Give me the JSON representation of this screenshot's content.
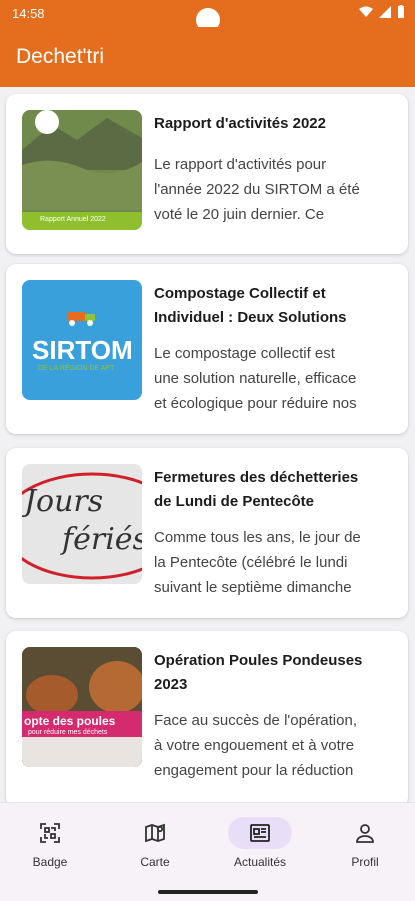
{
  "status": {
    "time": "14:58"
  },
  "app": {
    "title": "Dechet'tri"
  },
  "articles": [
    {
      "title": "Rapport d'activités 2022",
      "excerpt_lines": [
        "Le rapport d'activités pour",
        "l'année 2022 du SIRTOM a été",
        "voté le 20 juin dernier. Ce"
      ],
      "thumb_text": "Rapport Annuel 2022"
    },
    {
      "title_lines": [
        "Compostage Collectif et",
        "Individuel : Deux Solutions"
      ],
      "excerpt_lines": [
        "Le compostage collectif est",
        "une solution naturelle, efficace",
        "et écologique pour réduire nos"
      ],
      "thumb_text": "SIRTOM",
      "thumb_sub": "DE LA RÉGION DE APT"
    },
    {
      "title_lines": [
        "Fermetures des déchetteries",
        "de Lundi de Pentecôte"
      ],
      "excerpt_lines": [
        "Comme tous les ans, le jour de",
        "la Pentecôte (célébré le lundi",
        "suivant le septième dimanche"
      ],
      "thumb_text": [
        "Jours",
        "fériés"
      ]
    },
    {
      "title_lines": [
        "Opération Poules Pondeuses",
        "2023"
      ],
      "excerpt_lines": [
        "Face au succès de l'opération,",
        "à votre engouement et à votre",
        "engagement pour la réduction"
      ],
      "thumb_text": "opte des poules",
      "thumb_sub": "pour réduire mes déchets"
    }
  ],
  "nav": {
    "items": [
      "Badge",
      "Carte",
      "Actualités",
      "Profil"
    ],
    "active": "Actualités"
  },
  "colors": {
    "primary": "#e56d1e",
    "nav_active": "#e8def7"
  }
}
